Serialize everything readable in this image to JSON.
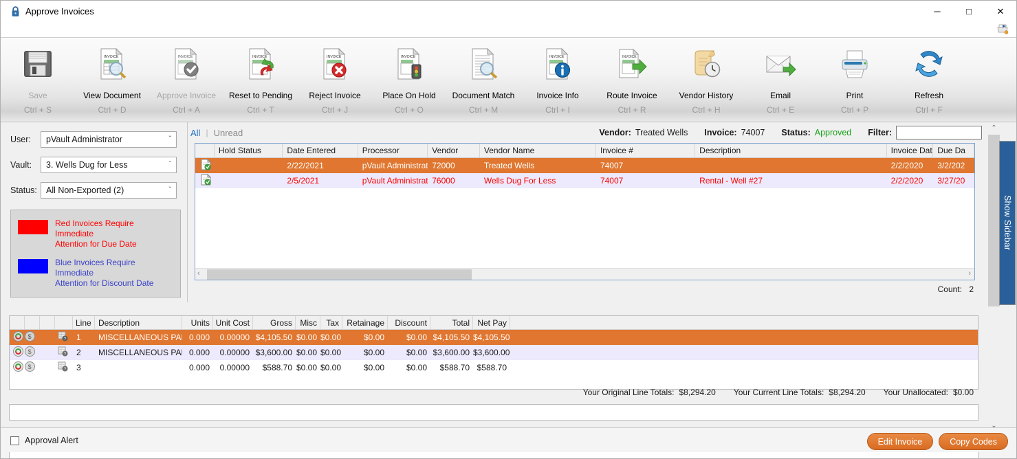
{
  "window": {
    "title": "Approve Invoices",
    "minimize": "─",
    "maximize": "□",
    "close": "✕"
  },
  "ribbon": [
    {
      "label": "Save",
      "key": "Ctrl + S",
      "icon": "floppy-disk-icon",
      "disabled": true
    },
    {
      "label": "View Document",
      "key": "Ctrl + D",
      "icon": "invoice-magnifier-icon",
      "disabled": false
    },
    {
      "label": "Approve Invoice",
      "key": "Ctrl + A",
      "icon": "invoice-check-icon",
      "disabled": true
    },
    {
      "label": "Reset to Pending",
      "key": "Ctrl + T",
      "icon": "invoice-undo-icon",
      "disabled": false
    },
    {
      "label": "Reject Invoice",
      "key": "Ctrl + J",
      "icon": "invoice-reject-icon",
      "disabled": false
    },
    {
      "label": "Place On Hold",
      "key": "Ctrl + O",
      "icon": "invoice-hold-icon",
      "disabled": false
    },
    {
      "label": "Document Match",
      "key": "Ctrl + M",
      "icon": "document-search-icon",
      "disabled": false
    },
    {
      "label": "Invoice Info",
      "key": "Ctrl + I",
      "icon": "invoice-info-icon",
      "disabled": false
    },
    {
      "label": "Route Invoice",
      "key": "Ctrl + R",
      "icon": "invoice-route-icon",
      "disabled": false
    },
    {
      "label": "Vendor History",
      "key": "Ctrl + H",
      "icon": "scroll-clock-icon",
      "disabled": false
    },
    {
      "label": "Email",
      "key": "Ctrl + E",
      "icon": "envelope-icon",
      "disabled": false
    },
    {
      "label": "Print",
      "key": "Ctrl + P",
      "icon": "printer-icon",
      "disabled": false
    },
    {
      "label": "Refresh",
      "key": "Ctrl + F",
      "icon": "refresh-arrows-icon",
      "disabled": false
    }
  ],
  "filters": {
    "user_label": "User:",
    "user_value": "pVault Administrator",
    "vault_label": "Vault:",
    "vault_value": "3. Wells Dug for Less",
    "status_label": "Status:",
    "status_value": "All Non-Exported (2)",
    "chevron": "ˇ"
  },
  "legend": {
    "red_color": "#ff0000",
    "blue_color": "#0000ff",
    "red_line1": "Red Invoices Require Immediate",
    "red_line2": "Attention for Due Date",
    "blue_line1": "Blue Invoices Require Immediate",
    "blue_line2": "Attention for Discount Date"
  },
  "list_header": {
    "tab_all": "All",
    "tab_sep": "|",
    "tab_unread": "Unread",
    "vendor_label": "Vendor:",
    "vendor_value": "Treated Wells",
    "invoice_label": "Invoice:",
    "invoice_value": "74007",
    "status_label": "Status:",
    "status_value": "Approved",
    "status_color": "#17a317",
    "filter_label": "Filter:",
    "filter_value": ""
  },
  "invoice_grid": {
    "columns": [
      "",
      "Hold Status",
      "Date Entered",
      "Processor",
      "Vendor",
      "Vendor Name",
      "Invoice #",
      "Description",
      "Invoice Date",
      "Due Da"
    ],
    "rows": [
      {
        "hold_status": "",
        "date_entered": "2/22/2021",
        "processor": "pVault Administrator",
        "vendor": "72000",
        "vendor_name": "Treated Wells",
        "invoice_no": "74007",
        "description": "",
        "invoice_date": "2/2/2020",
        "due_date": "3/2/202",
        "selected": true
      },
      {
        "hold_status": "",
        "date_entered": "2/5/2021",
        "processor": "pVault Administrator",
        "vendor": "76000",
        "vendor_name": "Wells Dug For Less",
        "invoice_no": "74007",
        "description": "Rental - Well #27",
        "invoice_date": "2/2/2020",
        "due_date": "3/27/20",
        "selected": false
      }
    ],
    "count_label": "Count:",
    "count_value": "2",
    "selected_row_color": "#e0762f",
    "alt_row_color": "#eceafc",
    "alt_row_text_color": "#ff0000"
  },
  "line_grid": {
    "columns": [
      "Line",
      "Description",
      "Units",
      "Unit Cost",
      "Gross",
      "Misc",
      "Tax",
      "Retainage",
      "Discount",
      "Total",
      "Net Pay"
    ],
    "rows": [
      {
        "line": "1",
        "description": "MISCELLANEOUS PARTS",
        "units": "0.000",
        "unit_cost": "0.00000",
        "gross": "$4,105.50",
        "misc": "$0.00",
        "tax": "$0.00",
        "retainage": "$0.00",
        "discount": "$0.00",
        "total": "$4,105.50",
        "net_pay": "$4,105.50",
        "selected": true
      },
      {
        "line": "2",
        "description": "MISCELLANEOUS PARTS",
        "units": "0.000",
        "unit_cost": "0.00000",
        "gross": "$3,600.00",
        "misc": "$0.00",
        "tax": "$0.00",
        "retainage": "$0.00",
        "discount": "$0.00",
        "total": "$3,600.00",
        "net_pay": "$3,600.00",
        "selected": false
      },
      {
        "line": "3",
        "description": "",
        "units": "0.000",
        "unit_cost": "0.00000",
        "gross": "$588.70",
        "misc": "$0.00",
        "tax": "$0.00",
        "retainage": "$0.00",
        "discount": "$0.00",
        "total": "$588.70",
        "net_pay": "$588.70",
        "selected": false
      }
    ]
  },
  "totals": {
    "original_label": "Your Original Line Totals:",
    "original_value": "$8,294.20",
    "current_label": "Your Current Line Totals:",
    "current_value": "$8,294.20",
    "unallocated_label": "Your Unallocated:",
    "unallocated_value": "$0.00"
  },
  "sidebar": {
    "show_label": "Show Sidebar"
  },
  "footer": {
    "approval_alert_label": "Approval Alert",
    "approval_alert_checked": false,
    "edit_invoice": "Edit Invoice",
    "copy_codes": "Copy Codes"
  },
  "scroll": {
    "up": "⌃",
    "down": "⌄",
    "left": "‹",
    "right": "›"
  }
}
